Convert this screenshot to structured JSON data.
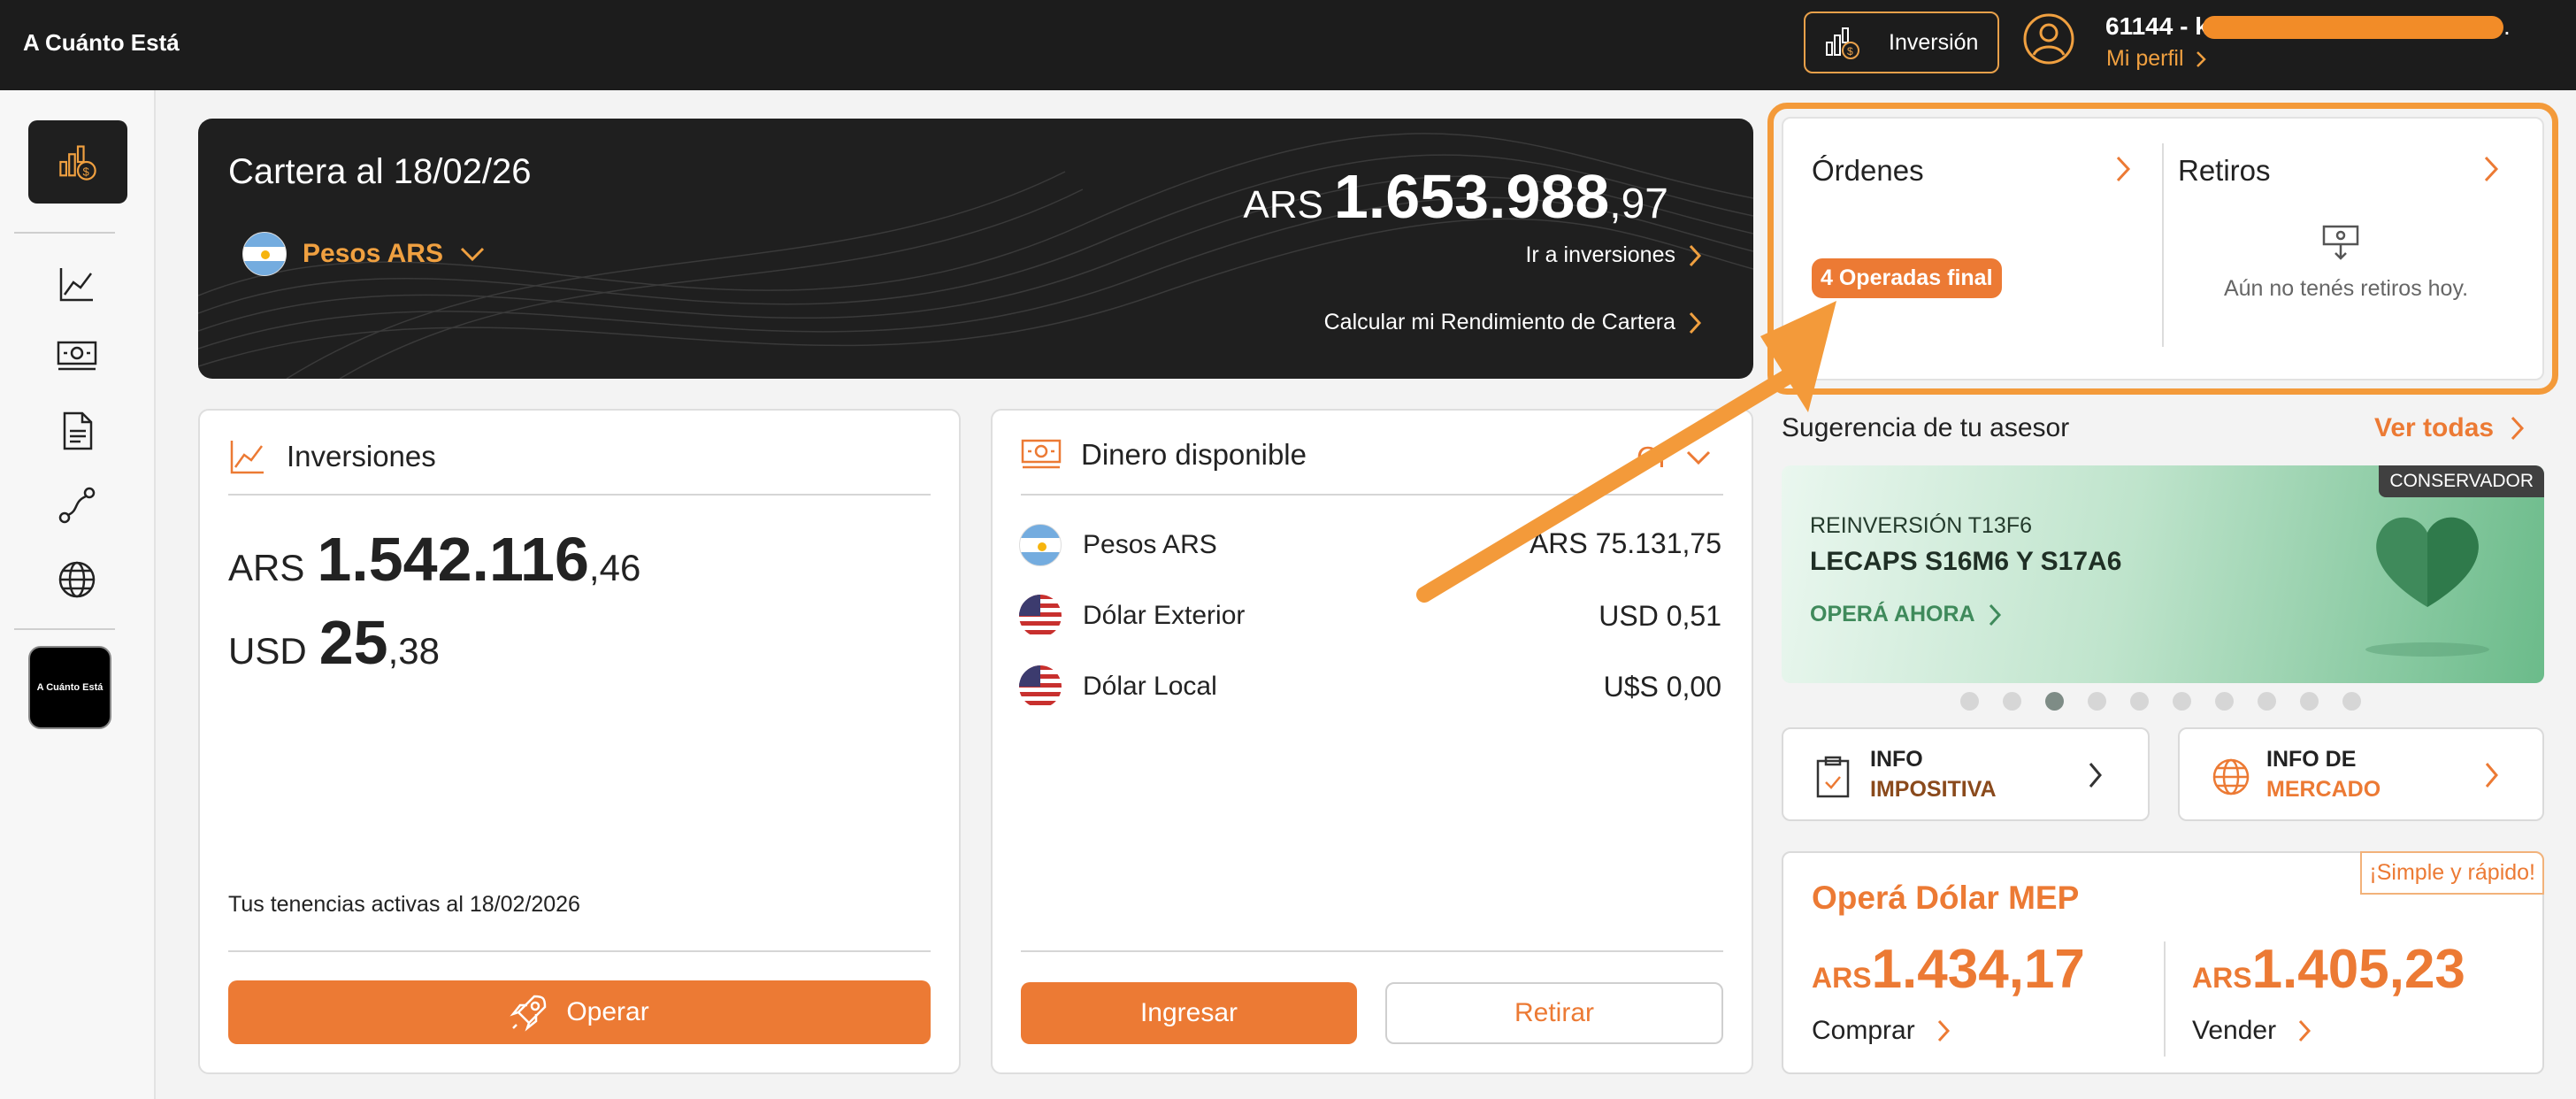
{
  "header": {
    "brand": "A Cuánto Está",
    "inversion_label": "Inversión",
    "account_number": "61144 - k",
    "account_tail": ".",
    "profile_link": "Mi perfil"
  },
  "sidebar": {
    "logo_text": "A Cuánto Está",
    "icons": [
      "portfolio-icon",
      "chart-line-icon",
      "money-icon",
      "document-icon",
      "route-icon",
      "globe-icon"
    ]
  },
  "cartera": {
    "title": "Cartera al 18/02/26",
    "currency": "Pesos ARS",
    "total_currency": "ARS",
    "total_int": "1.653.988",
    "total_dec": ",97",
    "link_inversiones": "Ir a inversiones",
    "link_rendimiento": "Calcular mi Rendimiento de Cartera"
  },
  "inversiones": {
    "title": "Inversiones",
    "ars_currency": "ARS",
    "ars_int": "1.542.116",
    "ars_dec": ",46",
    "usd_currency": "USD",
    "usd_int": "25",
    "usd_dec": ",38",
    "tenencias": "Tus tenencias activas al 18/02/2026",
    "operar_label": "Operar"
  },
  "dinero": {
    "title": "Dinero disponible",
    "selector": "CI",
    "rows": [
      {
        "label": "Pesos ARS",
        "value": "ARS 75.131,75"
      },
      {
        "label": "Dólar Exterior",
        "value": "USD 0,51"
      },
      {
        "label": "Dólar Local",
        "value": "U$S 0,00"
      }
    ],
    "ingresar_label": "Ingresar",
    "retirar_label": "Retirar"
  },
  "ordenes": {
    "title": "Órdenes",
    "badge": "4 Operadas final",
    "retiros_title": "Retiros",
    "retiros_empty": "Aún no tenés retiros hoy."
  },
  "sugerencia": {
    "title": "Sugerencia de tu asesor",
    "ver_todas": "Ver todas",
    "tag": "CONSERVADOR",
    "sub": "REINVERSIÓN T13F6",
    "main": "LECAPS S16M6 Y S17A6",
    "cta": "OPERÁ AHORA",
    "slides": 10,
    "active_slide": 3
  },
  "info": {
    "impositiva_l1": "INFO",
    "impositiva_l2": "IMPOSITIVA",
    "mercado_l1": "INFO DE",
    "mercado_l2": "MERCADO"
  },
  "mep": {
    "tag": "¡Simple y rápido!",
    "title": "Operá Dólar MEP",
    "buy_currency": "ARS",
    "buy_price": "1.434,17",
    "buy_label": "Comprar",
    "sell_currency": "ARS",
    "sell_price": "1.405,23",
    "sell_label": "Vender"
  },
  "colors": {
    "accent": "#ec7a34",
    "highlight": "#f39a3a",
    "dark": "#1f1f1f"
  }
}
